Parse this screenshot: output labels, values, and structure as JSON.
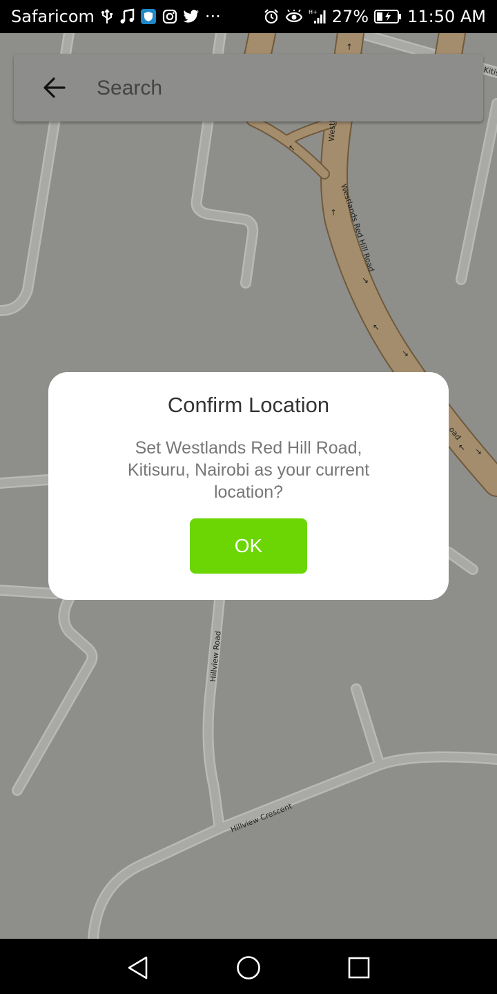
{
  "status_bar": {
    "carrier": "Safaricom",
    "network": "H+",
    "battery_percent": "27%",
    "time": "11:50 AM",
    "more": "···"
  },
  "map": {
    "roads": {
      "westlands_red_hill_road": "Westlands Red Hill Road",
      "westlands_short": "Westl",
      "kitisuru_short": "Kitis",
      "road_fragment": "oad",
      "hillview_road": "Hillview Road",
      "hillview_crescent": "Hillview Crescent"
    }
  },
  "search": {
    "placeholder": "Search"
  },
  "dialog": {
    "title": "Confirm Location",
    "message": "Set Westlands Red Hill Road, Kitisuru, Nairobi as your current location?",
    "ok_label": "OK",
    "ok_color": "#6bd604"
  },
  "colors": {
    "map_background": "#8e8e8a",
    "main_road": "#a48d6c",
    "minor_road": "#a9a9a6"
  }
}
